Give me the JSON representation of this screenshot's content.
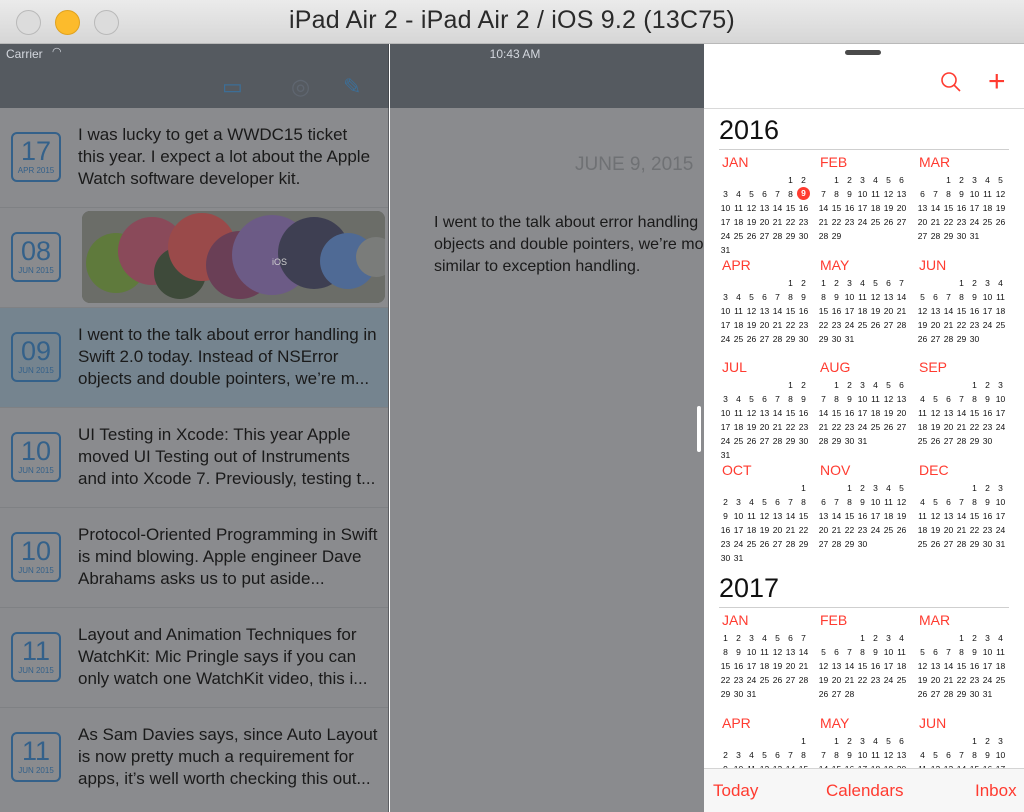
{
  "window": {
    "title": "iPad Air 2 - iPad Air 2 / iOS 9.2 (13C75)"
  },
  "status_bar": {
    "carrier": "Carrier",
    "time": "10:43 AM"
  },
  "entries": [
    {
      "day": "17",
      "month": "APR 2015",
      "text": "I was lucky to get a WWDC15 ticket this year. I expect a lot about the Apple Watch software developer kit."
    },
    {
      "day": "08",
      "month": "JUN 2015",
      "text": ""
    },
    {
      "day": "09",
      "month": "JUN 2015",
      "text": "I went to the talk about error handling in Swift 2.0 today. Instead of NSError objects and double pointers, we’re m..."
    },
    {
      "day": "10",
      "month": "JUN 2015",
      "text": "UI Testing in Xcode: This year Apple moved UI Testing out of Instruments and into Xcode 7. Previously, testing t..."
    },
    {
      "day": "10",
      "month": "JUN 2015",
      "text": "Protocol-Oriented Programming in Swift is mind blowing. Apple engineer Dave Abrahams asks us to put aside..."
    },
    {
      "day": "11",
      "month": "JUN 2015",
      "text": "Layout and Animation Techniques for WatchKit: Mic Pringle says if you can only watch one WatchKit video, this i..."
    },
    {
      "day": "11",
      "month": "JUN 2015",
      "text": "As Sam Davies says, since Auto Layout is now pretty much a requirement for apps, it’s well worth checking this out..."
    }
  ],
  "detail": {
    "date": "JUNE 9, 2015",
    "body_lines": [
      "I went to the talk about error handling",
      "objects and double pointers, we’re mo",
      "similar to exception handling."
    ]
  },
  "calendar": {
    "toolbar": {
      "today": "Today",
      "calendars": "Calendars",
      "inbox": "Inbox"
    },
    "colors": {
      "accent": "#ff3b30"
    },
    "icons": {
      "search": "search-icon",
      "add": "plus-icon"
    },
    "years": [
      {
        "year": "2016",
        "months": [
          {
            "name": "JAN",
            "offset": 5,
            "days": 31,
            "today": 9
          },
          {
            "name": "FEB",
            "offset": 1,
            "days": 29
          },
          {
            "name": "MAR",
            "offset": 2,
            "days": 31
          },
          {
            "name": "APR",
            "offset": 5,
            "days": 30
          },
          {
            "name": "MAY",
            "offset": 0,
            "days": 31
          },
          {
            "name": "JUN",
            "offset": 3,
            "days": 30
          },
          {
            "name": "JUL",
            "offset": 5,
            "days": 31
          },
          {
            "name": "AUG",
            "offset": 1,
            "days": 31
          },
          {
            "name": "SEP",
            "offset": 4,
            "days": 30
          },
          {
            "name": "OCT",
            "offset": 6,
            "days": 31
          },
          {
            "name": "NOV",
            "offset": 2,
            "days": 30
          },
          {
            "name": "DEC",
            "offset": 4,
            "days": 31
          }
        ]
      },
      {
        "year": "2017",
        "months": [
          {
            "name": "JAN",
            "offset": 0,
            "days": 31
          },
          {
            "name": "FEB",
            "offset": 3,
            "days": 28
          },
          {
            "name": "MAR",
            "offset": 3,
            "days": 31
          },
          {
            "name": "APR",
            "offset": 6,
            "days": 30
          },
          {
            "name": "MAY",
            "offset": 1,
            "days": 31
          },
          {
            "name": "JUN",
            "offset": 4,
            "days": 30
          }
        ]
      }
    ]
  }
}
